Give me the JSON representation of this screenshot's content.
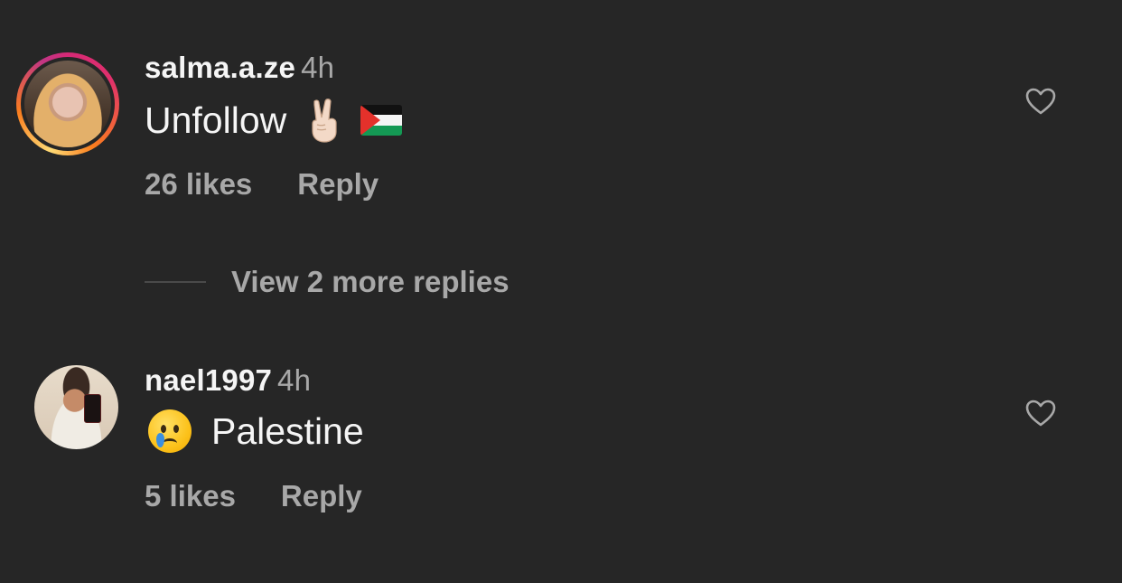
{
  "comments": [
    {
      "username": "salma.a.ze",
      "time": "4h",
      "text": "Unfollow",
      "emojis": [
        "victory-hand",
        "palestine-flag"
      ],
      "likes": "26 likes",
      "reply_label": "Reply",
      "has_story_ring": true
    },
    {
      "username": "nael1997",
      "time": "4h",
      "text": "Palestine",
      "emojis": [
        "crying-face"
      ],
      "likes": "5 likes",
      "reply_label": "Reply",
      "has_story_ring": false
    }
  ],
  "view_more": {
    "label": "View 2 more replies"
  },
  "colors": {
    "background": "#262626",
    "primary_text": "#f5f5f5",
    "secondary_text": "#a8a8a8"
  }
}
